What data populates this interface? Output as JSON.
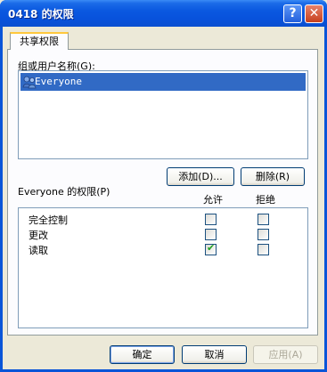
{
  "window": {
    "title": "0418 的权限",
    "help_glyph": "?",
    "close_glyph": "✕"
  },
  "tabs": [
    {
      "label": "共享权限"
    }
  ],
  "users": {
    "label": "组或用户名称(G):",
    "items": [
      {
        "name": "Everyone",
        "selected": true
      }
    ],
    "add_label": "添加(D)...",
    "remove_label": "删除(R)"
  },
  "permissions": {
    "label": "Everyone 的权限(P)",
    "allow_header": "允许",
    "deny_header": "拒绝",
    "rows": [
      {
        "name": "完全控制",
        "allow": false,
        "deny": false
      },
      {
        "name": "更改",
        "allow": false,
        "deny": false
      },
      {
        "name": "读取",
        "allow": true,
        "deny": false
      }
    ]
  },
  "footer": {
    "ok_label": "确定",
    "cancel_label": "取消",
    "apply_label": "应用(A)"
  },
  "colors": {
    "titlebar": "#0a58e0",
    "selection": "#316ac5",
    "dialog": "#ece9d8",
    "checkmark": "#21a121"
  },
  "check_glyph": "✔"
}
